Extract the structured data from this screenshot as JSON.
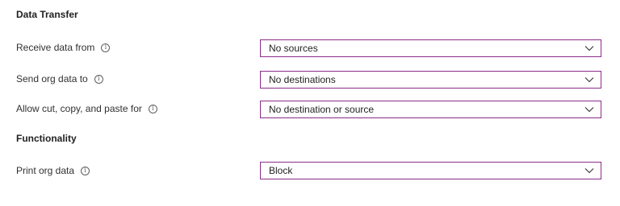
{
  "sections": {
    "data_transfer": {
      "title": "Data Transfer"
    },
    "functionality": {
      "title": "Functionality"
    }
  },
  "rows": {
    "receive": {
      "label": "Receive data from",
      "value": "No sources"
    },
    "send": {
      "label": "Send org data to",
      "value": "No destinations"
    },
    "cutcopy": {
      "label": "Allow cut, copy, and paste for",
      "value": "No destination or source"
    },
    "print": {
      "label": "Print org data",
      "value": "Block"
    }
  },
  "icons": {
    "info": "info-icon",
    "dropdown": "chevron-down-icon"
  },
  "colors": {
    "dropdown_border": "#8a2c8a",
    "text": "#323130"
  }
}
